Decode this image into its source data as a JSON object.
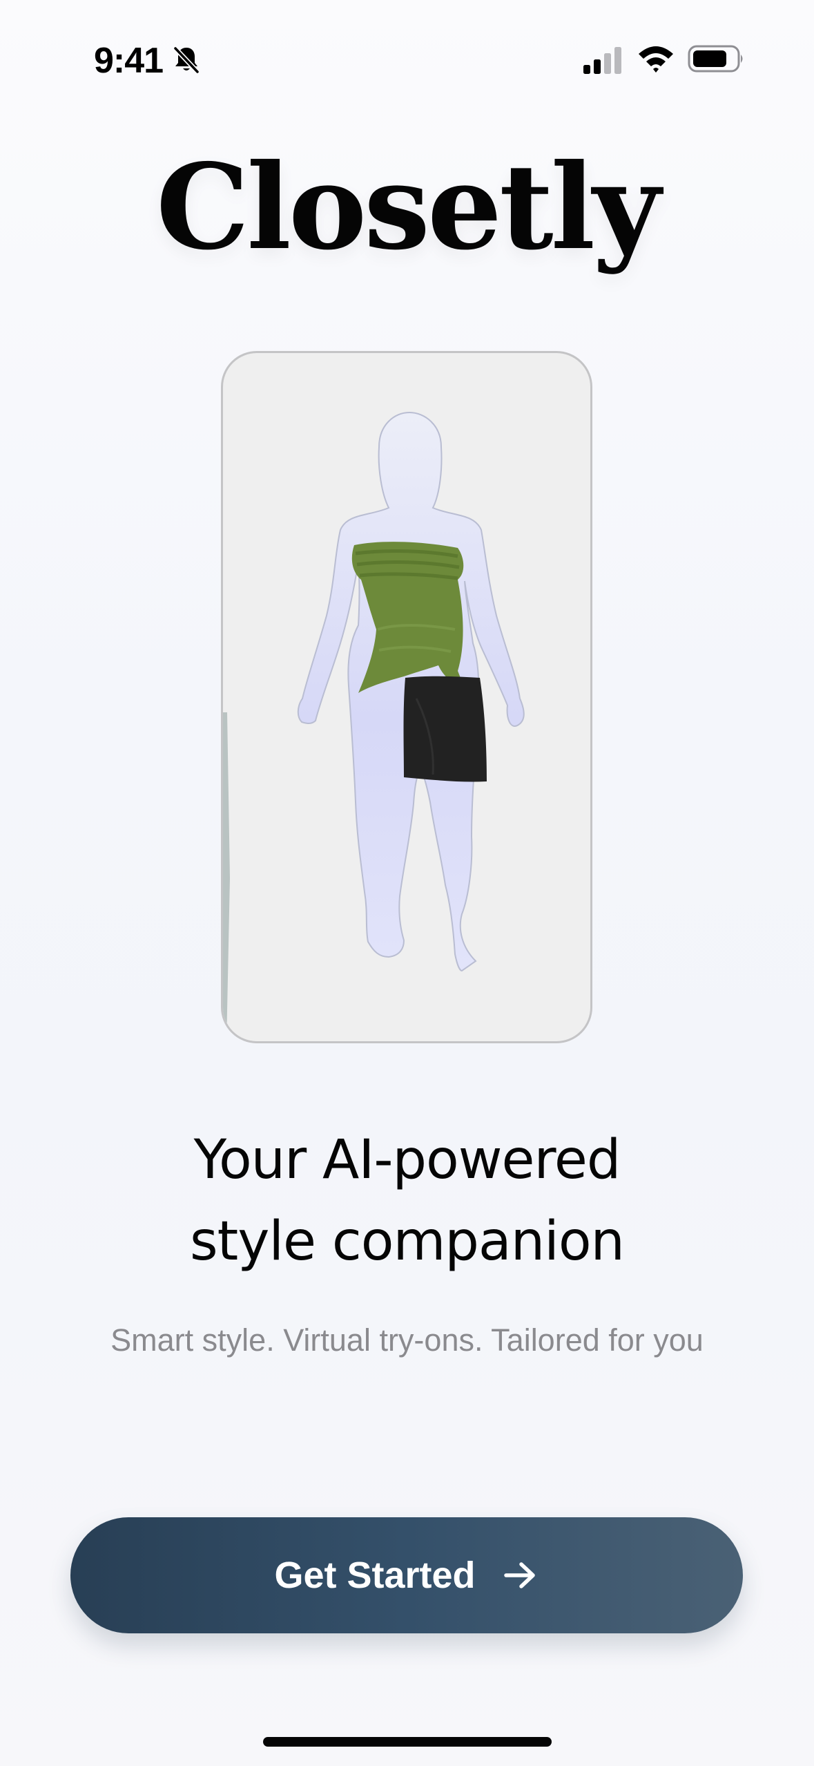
{
  "status_bar": {
    "time": "9:41",
    "icons": [
      "bell-slash-icon",
      "cellular-signal-icon",
      "wifi-icon",
      "battery-icon"
    ]
  },
  "app": {
    "title": "Closetly"
  },
  "preview": {
    "icon": "mannequin-outfit-illustration",
    "colors": {
      "card_background": "#efefef",
      "card_border": "#c4c4c6",
      "silhouette": "#d8daf8",
      "top": "#6d8a3a",
      "skirt": "#222222"
    }
  },
  "onboarding": {
    "headline_line1": "Your AI-powered",
    "headline_line2": "style companion",
    "tagline": "Smart style. Virtual try-ons. Tailored for you"
  },
  "cta": {
    "label": "Get Started",
    "icon": "arrow-right-icon",
    "color_start": "#283f55",
    "color_end": "#4a6175"
  }
}
